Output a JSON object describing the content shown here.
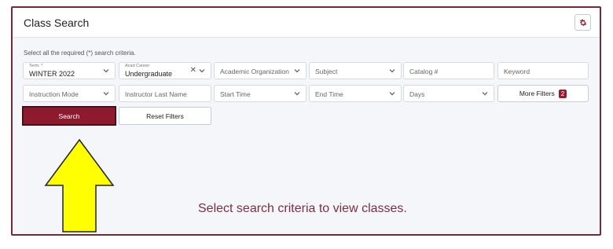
{
  "header": {
    "title": "Class Search"
  },
  "hint": "Select all the required (*) search criteria.",
  "row1": {
    "term_label": "Term: *",
    "term_value": "WINTER 2022",
    "career_label": "Acad Career:",
    "career_value": "Undergraduate",
    "academic_org": "Academic Organization",
    "subject": "Subject",
    "catalog": "Catalog #",
    "keyword": "Keyword"
  },
  "row2": {
    "instruction_mode": "Instruction Mode",
    "instructor": "Instructor Last Name",
    "start_time": "Start Time",
    "end_time": "End Time",
    "days": "Days",
    "more_filters": "More Filters",
    "more_filters_count": "2"
  },
  "buttons": {
    "search": "Search",
    "reset": "Reset Filters"
  },
  "empty_message": "Select search criteria to view classes.",
  "colors": {
    "accent": "#8e1a2e",
    "arrow": "#ffff00"
  },
  "icons": {
    "settings": "gear-icon",
    "dropdown": "chevron-down-icon",
    "clear": "close-icon",
    "annotation": "up-arrow-icon"
  }
}
